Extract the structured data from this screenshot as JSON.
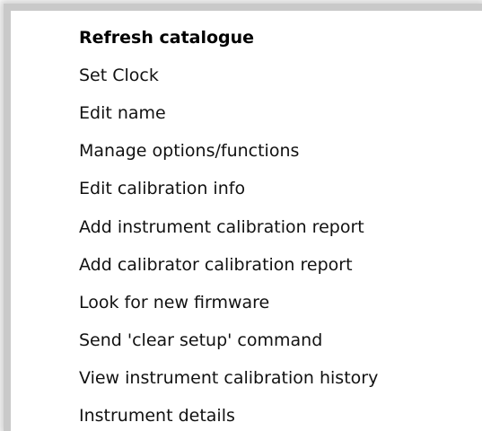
{
  "context_menu": {
    "items": [
      {
        "label": "Refresh catalogue",
        "default": true
      },
      {
        "label": "Set Clock"
      },
      {
        "label": "Edit name"
      },
      {
        "label": "Manage options/functions"
      },
      {
        "label": "Edit calibration info"
      },
      {
        "label": "Add instrument calibration report"
      },
      {
        "label": "Add calibrator calibration report"
      },
      {
        "label": "Look for new firmware"
      },
      {
        "label": "Send 'clear setup' command"
      },
      {
        "label": "View instrument calibration history"
      },
      {
        "label": "Instrument details"
      }
    ]
  }
}
